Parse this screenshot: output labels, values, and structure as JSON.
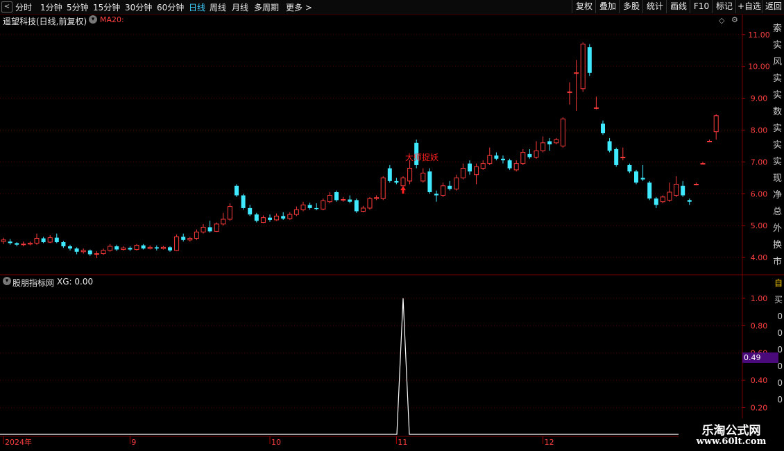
{
  "toolbar": {
    "back_glyph": "<",
    "periods": [
      "分时",
      "1分钟",
      "5分钟",
      "15分钟",
      "30分钟",
      "60分钟",
      "日线",
      "周线",
      "月线",
      "多周期",
      "更多 >"
    ],
    "active_period": "日线",
    "right_buttons": [
      "复权",
      "叠加",
      "多股",
      "统计",
      "画线",
      "F10",
      "标记",
      "+自选",
      "返回"
    ]
  },
  "main_panel": {
    "title": "遥望科技(日线,前复权)",
    "indicator": "MA20:",
    "signal_text": "大师捉妖",
    "right_side_glyphs": [
      "索",
      "实",
      "风",
      "实",
      "实",
      "数",
      "实",
      "实",
      "实",
      "现",
      "净",
      "总",
      "外",
      "换",
      "市"
    ]
  },
  "sub_panel": {
    "title": "股朋指标网",
    "value_text": "XG: 0.00",
    "current_value_label": "0.49",
    "right_side_glyphs": [
      "自",
      "买",
      "0",
      "0",
      "0",
      "0",
      "0",
      "0"
    ]
  },
  "watermark": {
    "line1": "乐淘公式网",
    "line2": "www.60lt.com"
  },
  "colors": {
    "up": "#ff3b3b",
    "down": "#3fe9ff",
    "grid": "#5a0000",
    "axis_text": "#ff4040",
    "signal": "#ff2020",
    "indicator_line": "#ffffff",
    "highlight": "#4a0a7a"
  },
  "chart_data": [
    {
      "type": "candlestick",
      "title": "遥望科技(日线,前复权)",
      "y_ticks": [
        4.0,
        5.0,
        6.0,
        7.0,
        8.0,
        9.0,
        10.0,
        11.0
      ],
      "ylim": [
        3.5,
        11.3
      ],
      "x_ticks": [
        "2024年",
        "9",
        "10",
        "11",
        "12",
        "1"
      ],
      "x_tick_index": [
        0,
        19,
        40,
        59,
        81,
        106
      ],
      "candles": [
        [
          4.5,
          4.55,
          4.62,
          4.42
        ],
        [
          4.5,
          4.45,
          4.58,
          4.4
        ],
        [
          4.45,
          4.4,
          4.48,
          4.35
        ],
        [
          4.4,
          4.42,
          4.5,
          4.35
        ],
        [
          4.42,
          4.45,
          4.5,
          4.38
        ],
        [
          4.45,
          4.6,
          4.75,
          4.4
        ],
        [
          4.6,
          4.48,
          4.65,
          4.45
        ],
        [
          4.48,
          4.62,
          4.7,
          4.45
        ],
        [
          4.62,
          4.48,
          4.75,
          4.45
        ],
        [
          4.48,
          4.35,
          4.52,
          4.3
        ],
        [
          4.35,
          4.28,
          4.4,
          4.22
        ],
        [
          4.28,
          4.18,
          4.32,
          4.1
        ],
        [
          4.18,
          4.22,
          4.28,
          4.12
        ],
        [
          4.22,
          4.1,
          4.25,
          4.05
        ],
        [
          4.1,
          4.12,
          4.2,
          3.98
        ],
        [
          4.12,
          4.22,
          4.28,
          4.08
        ],
        [
          4.22,
          4.35,
          4.42,
          4.18
        ],
        [
          4.35,
          4.25,
          4.4,
          4.2
        ],
        [
          4.25,
          4.3,
          4.35,
          4.22
        ],
        [
          4.3,
          4.25,
          4.35,
          4.2
        ],
        [
          4.25,
          4.38,
          4.42,
          4.22
        ],
        [
          4.38,
          4.28,
          4.42,
          4.25
        ],
        [
          4.28,
          4.32,
          4.38,
          4.25
        ],
        [
          4.32,
          4.28,
          4.38,
          4.22
        ],
        [
          4.28,
          4.32,
          4.36,
          4.25
        ],
        [
          4.32,
          4.22,
          4.35,
          4.18
        ],
        [
          4.22,
          4.65,
          4.72,
          4.2
        ],
        [
          4.65,
          4.55,
          4.75,
          4.5
        ],
        [
          4.55,
          4.6,
          4.65,
          4.5
        ],
        [
          4.6,
          4.8,
          4.88,
          4.55
        ],
        [
          4.8,
          4.95,
          5.05,
          4.75
        ],
        [
          4.95,
          4.82,
          5.15,
          4.78
        ],
        [
          4.82,
          5.05,
          5.1,
          4.8
        ],
        [
          5.05,
          5.2,
          5.4,
          5.0
        ],
        [
          5.2,
          5.6,
          5.7,
          5.15
        ],
        [
          6.25,
          5.95,
          6.3,
          5.9
        ],
        [
          5.95,
          5.55,
          6.0,
          5.5
        ],
        [
          5.55,
          5.35,
          5.65,
          5.3
        ],
        [
          5.35,
          5.15,
          5.4,
          5.1
        ],
        [
          5.1,
          5.25,
          5.32,
          5.08
        ],
        [
          5.25,
          5.18,
          5.35,
          5.12
        ],
        [
          5.18,
          5.3,
          5.38,
          5.15
        ],
        [
          5.3,
          5.22,
          5.42,
          5.18
        ],
        [
          5.22,
          5.35,
          5.42,
          5.18
        ],
        [
          5.35,
          5.5,
          5.6,
          5.3
        ],
        [
          5.5,
          5.65,
          5.75,
          5.45
        ],
        [
          5.65,
          5.55,
          5.72,
          5.5
        ],
        [
          5.55,
          5.52,
          5.7,
          5.48
        ],
        [
          5.52,
          5.78,
          5.85,
          5.48
        ],
        [
          5.75,
          5.95,
          6.05,
          5.7
        ],
        [
          6.05,
          5.8,
          6.1,
          5.75
        ],
        [
          5.8,
          5.82,
          5.9,
          5.75
        ],
        [
          5.82,
          5.75,
          5.95,
          5.7
        ],
        [
          5.8,
          5.45,
          5.85,
          5.4
        ],
        [
          5.45,
          5.55,
          5.62,
          5.42
        ],
        [
          5.55,
          5.85,
          5.9,
          5.5
        ],
        [
          5.85,
          5.88,
          5.95,
          5.8
        ],
        [
          5.85,
          6.5,
          6.55,
          5.8
        ],
        [
          6.8,
          6.4,
          6.9,
          6.35
        ],
        [
          6.4,
          6.35,
          6.5,
          6.3
        ],
        [
          6.25,
          6.5,
          6.55,
          6.2
        ],
        [
          6.4,
          6.8,
          7.05,
          6.3
        ],
        [
          7.6,
          6.9,
          7.7,
          6.8
        ],
        [
          6.4,
          6.65,
          6.8,
          6.35
        ],
        [
          6.7,
          6.05,
          6.8,
          6.0
        ],
        [
          6.0,
          5.95,
          6.1,
          5.75
        ],
        [
          5.95,
          6.25,
          6.35,
          5.9
        ],
        [
          6.25,
          6.15,
          6.4,
          6.1
        ],
        [
          6.15,
          6.5,
          6.6,
          6.1
        ],
        [
          6.5,
          6.8,
          6.95,
          6.45
        ],
        [
          6.95,
          6.7,
          7.05,
          6.6
        ],
        [
          6.6,
          6.85,
          6.95,
          6.3
        ],
        [
          6.8,
          6.95,
          7.05,
          6.75
        ],
        [
          6.95,
          7.2,
          7.45,
          6.9
        ],
        [
          7.2,
          7.1,
          7.3,
          7.05
        ],
        [
          7.1,
          7.05,
          7.2,
          6.95
        ],
        [
          7.05,
          6.8,
          7.1,
          6.75
        ],
        [
          6.75,
          6.95,
          7.05,
          6.7
        ],
        [
          6.95,
          7.3,
          7.4,
          6.9
        ],
        [
          7.25,
          7.15,
          7.4,
          7.1
        ],
        [
          7.15,
          7.35,
          7.65,
          7.1
        ],
        [
          7.35,
          7.6,
          7.8,
          7.3
        ],
        [
          7.65,
          7.55,
          7.75,
          7.35
        ],
        [
          7.6,
          7.7,
          7.75,
          7.55
        ],
        [
          7.5,
          8.35,
          8.4,
          7.45
        ],
        [
          9.2,
          9.2,
          9.5,
          8.8
        ],
        [
          9.8,
          9.8,
          10.2,
          8.6
        ],
        [
          9.3,
          10.7,
          10.75,
          9.2
        ],
        [
          10.6,
          9.8,
          10.7,
          9.7
        ],
        [
          8.7,
          8.7,
          9.05,
          8.65
        ],
        [
          8.2,
          7.9,
          8.3,
          7.85
        ],
        [
          7.65,
          7.35,
          7.75,
          7.3
        ],
        [
          7.4,
          6.9,
          7.45,
          6.85
        ],
        [
          7.15,
          7.15,
          7.45,
          7.05
        ],
        [
          6.9,
          6.7,
          6.95,
          6.65
        ],
        [
          6.7,
          6.35,
          6.75,
          6.3
        ],
        [
          6.5,
          6.45,
          6.9,
          6.4
        ],
        [
          6.35,
          5.85,
          6.4,
          5.8
        ],
        [
          5.85,
          5.65,
          5.9,
          5.55
        ],
        [
          5.75,
          5.9,
          5.95,
          5.7
        ],
        [
          5.8,
          6.05,
          6.35,
          5.75
        ],
        [
          5.95,
          6.3,
          6.55,
          5.9
        ],
        [
          6.25,
          5.95,
          6.4,
          5.9
        ],
        [
          5.8,
          5.75,
          5.85,
          5.65
        ],
        [
          6.3,
          6.3,
          6.35,
          6.3
        ],
        [
          6.95,
          6.95,
          7.0,
          6.95
        ],
        [
          7.65,
          7.65,
          7.7,
          7.65
        ],
        [
          7.95,
          8.45,
          8.5,
          7.7
        ]
      ],
      "signal_index": 60
    },
    {
      "type": "line",
      "title": "股朋指标网",
      "y_ticks": [
        0.2,
        0.4,
        0.6,
        0.8,
        1.0
      ],
      "ylim": [
        0,
        1.05
      ],
      "series": [
        {
          "name": "XG",
          "spike_index": 60,
          "values_note_value": 1.0
        }
      ]
    }
  ]
}
